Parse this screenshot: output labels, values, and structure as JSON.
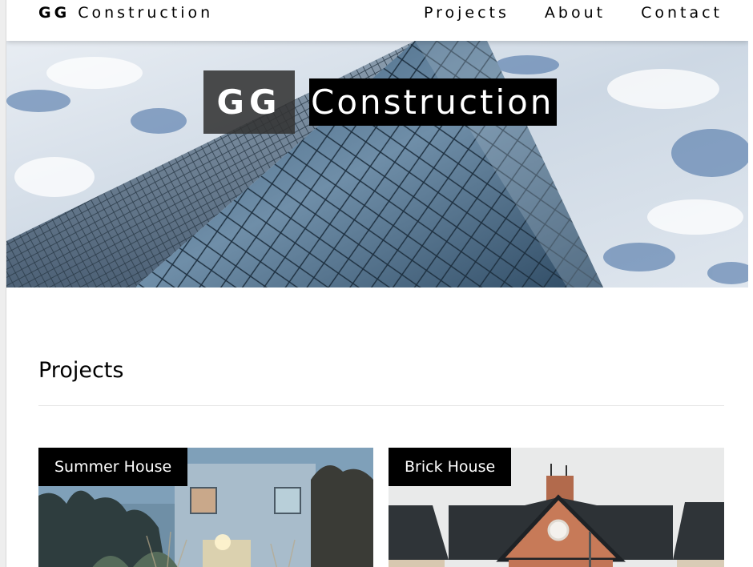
{
  "header": {
    "brand_bold": "GG",
    "brand_rest": "Construction",
    "nav": [
      {
        "label": "Projects"
      },
      {
        "label": "About"
      },
      {
        "label": "Contact"
      }
    ]
  },
  "hero": {
    "title_initials": "GG",
    "title_word": "Construction"
  },
  "projects": {
    "heading": "Projects",
    "cards": [
      {
        "label": "Summer House"
      },
      {
        "label": "Brick House"
      }
    ]
  },
  "colors": {
    "accent": "#000000",
    "initials_box": "#333333",
    "page_bg": "#ffffff"
  }
}
